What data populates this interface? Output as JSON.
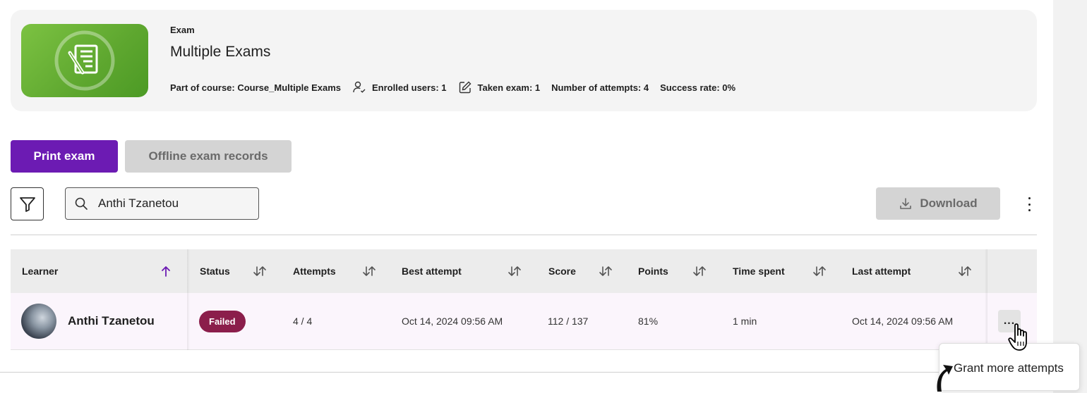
{
  "exam": {
    "label": "Exam",
    "title": "Multiple Exams",
    "meta": {
      "course": "Part of course: Course_Multiple Exams",
      "enrolled": "Enrolled users: 1",
      "taken": "Taken exam: 1",
      "attempts": "Number of attempts: 4",
      "success": "Success rate: 0%"
    },
    "thumbnail_color": "#6cb33a"
  },
  "buttons": {
    "print": "Print exam",
    "offline": "Offline exam records",
    "download": "Download"
  },
  "search": {
    "value": "Anthi Tzanetou",
    "placeholder": ""
  },
  "table": {
    "columns": [
      {
        "label": "Learner",
        "sort": "asc"
      },
      {
        "label": "Status",
        "sort": "none"
      },
      {
        "label": "Attempts",
        "sort": "none"
      },
      {
        "label": "Best attempt",
        "sort": "none"
      },
      {
        "label": "Score",
        "sort": "none"
      },
      {
        "label": "Points",
        "sort": "none"
      },
      {
        "label": "Time spent",
        "sort": "none"
      },
      {
        "label": "Last attempt",
        "sort": "none"
      }
    ],
    "rows": [
      {
        "learner": "Anthi Tzanetou",
        "status": "Failed",
        "attempts": "4 / 4",
        "best_attempt": "Oct 14, 2024 09:56 AM",
        "score": "112 / 137",
        "points": "81%",
        "time_spent": "1 min",
        "last_attempt": "Oct 14, 2024 09:56 AM",
        "actions_label": "..."
      }
    ]
  },
  "popover": {
    "items": [
      "Grant more attempts"
    ]
  },
  "colors": {
    "primary": "#6c1bb3",
    "failed_badge": "#8b1e4b",
    "sort_active": "#6c1bb3",
    "disabled_button": "#d4d4d4"
  }
}
